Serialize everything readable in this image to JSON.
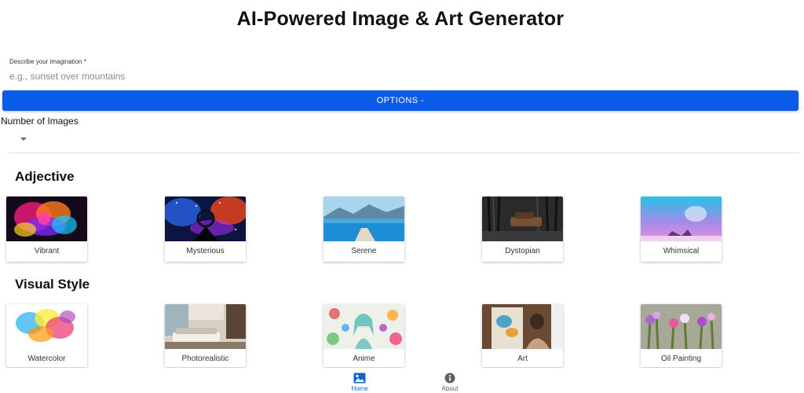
{
  "title": "AI-Powered Image & Art Generator",
  "prompt": {
    "label": "Describe your imagination *",
    "placeholder": "e.g., sunset over mountains",
    "value": ""
  },
  "options_button": "OPTIONS -",
  "num_images": {
    "label": "Number of Images",
    "value": ""
  },
  "sections": [
    {
      "title": "Adjective",
      "items": [
        {
          "label": "Vibrant",
          "image": "colorful-ink-explosion"
        },
        {
          "label": "Mysterious",
          "image": "galaxy-silhouette"
        },
        {
          "label": "Serene",
          "image": "lake-pier-mountains"
        },
        {
          "label": "Dystopian",
          "image": "ruined-car-dark-forest"
        },
        {
          "label": "Whimsical",
          "image": "purple-sky-fantasy-creature"
        }
      ]
    },
    {
      "title": "Visual Style",
      "items": [
        {
          "label": "Watercolor",
          "image": "watercolor-splash"
        },
        {
          "label": "Photorealistic",
          "image": "modern-living-room"
        },
        {
          "label": "Anime",
          "image": "anime-girl-flowers"
        },
        {
          "label": "Art",
          "image": "painter-at-easel"
        },
        {
          "label": "Oil Painting",
          "image": "oil-painted-flowers"
        }
      ]
    }
  ],
  "bottom_nav": [
    {
      "label": "Home",
      "icon": "image-icon",
      "active": true
    },
    {
      "label": "About",
      "icon": "info-icon",
      "active": false
    }
  ],
  "colors": {
    "accent": "#0b5bea",
    "nav_active": "#1565c0",
    "nav_inactive": "#757575"
  }
}
